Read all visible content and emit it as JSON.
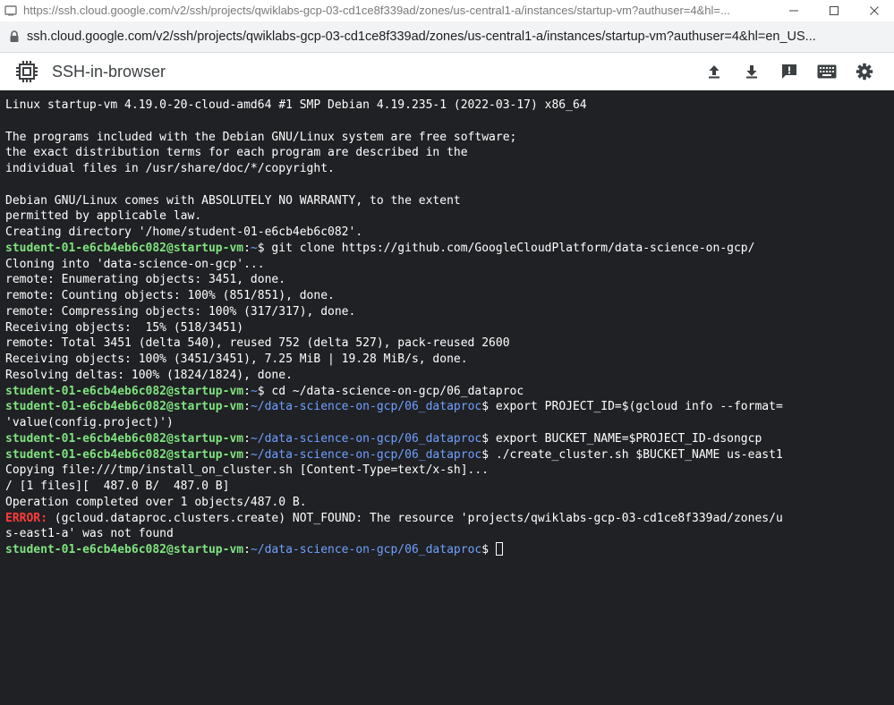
{
  "window": {
    "title": "https://ssh.cloud.google.com/v2/ssh/projects/qwiklabs-gcp-03-cd1ce8f339ad/zones/us-central1-a/instances/startup-vm?authuser=4&hl=..."
  },
  "address_bar": {
    "url": "ssh.cloud.google.com/v2/ssh/projects/qwiklabs-gcp-03-cd1ce8f339ad/zones/us-central1-a/instances/startup-vm?authuser=4&hl=en_US..."
  },
  "app": {
    "title": "SSH-in-browser",
    "tools": [
      {
        "name": "upload-icon"
      },
      {
        "name": "download-icon"
      },
      {
        "name": "feedback-icon"
      },
      {
        "name": "keyboard-icon"
      },
      {
        "name": "settings-icon"
      }
    ]
  },
  "terminal": {
    "prompt_user": "student-01-e6cb4eb6c082@startup-vm",
    "home_path": "~",
    "project_path": "~/data-science-on-gcp/06_dataproc",
    "lines": [
      {
        "t": "text",
        "text": "Linux startup-vm 4.19.0-20-cloud-amd64 #1 SMP Debian 4.19.235-1 (2022-03-17) x86_64"
      },
      {
        "t": "blank"
      },
      {
        "t": "text",
        "text": "The programs included with the Debian GNU/Linux system are free software;"
      },
      {
        "t": "text",
        "text": "the exact distribution terms for each program are described in the"
      },
      {
        "t": "text",
        "text": "individual files in /usr/share/doc/*/copyright."
      },
      {
        "t": "blank"
      },
      {
        "t": "text",
        "text": "Debian GNU/Linux comes with ABSOLUTELY NO WARRANTY, to the extent"
      },
      {
        "t": "text",
        "text": "permitted by applicable law."
      },
      {
        "t": "text",
        "text": "Creating directory '/home/student-01-e6cb4eb6c082'."
      },
      {
        "t": "prompt",
        "user": "student-01-e6cb4eb6c082@startup-vm",
        "path": "~",
        "cmd": "git clone https://github.com/GoogleCloudPlatform/data-science-on-gcp/"
      },
      {
        "t": "text",
        "text": "Cloning into 'data-science-on-gcp'..."
      },
      {
        "t": "text",
        "text": "remote: Enumerating objects: 3451, done."
      },
      {
        "t": "text",
        "text": "remote: Counting objects: 100% (851/851), done."
      },
      {
        "t": "text",
        "text": "remote: Compressing objects: 100% (317/317), done."
      },
      {
        "t": "text",
        "text": "Receiving objects:  15% (518/3451)"
      },
      {
        "t": "text",
        "text": "remote: Total 3451 (delta 540), reused 752 (delta 527), pack-reused 2600"
      },
      {
        "t": "text",
        "text": "Receiving objects: 100% (3451/3451), 7.25 MiB | 19.28 MiB/s, done."
      },
      {
        "t": "text",
        "text": "Resolving deltas: 100% (1824/1824), done."
      },
      {
        "t": "prompt",
        "user": "student-01-e6cb4eb6c082@startup-vm",
        "path": "~",
        "cmd": "cd ~/data-science-on-gcp/06_dataproc"
      },
      {
        "t": "prompt",
        "user": "student-01-e6cb4eb6c082@startup-vm",
        "path": "~/data-science-on-gcp/06_dataproc",
        "cmd": "export PROJECT_ID=$(gcloud info --format="
      },
      {
        "t": "text",
        "text": "'value(config.project)')"
      },
      {
        "t": "prompt",
        "user": "student-01-e6cb4eb6c082@startup-vm",
        "path": "~/data-science-on-gcp/06_dataproc",
        "cmd": "export BUCKET_NAME=$PROJECT_ID-dsongcp"
      },
      {
        "t": "prompt",
        "user": "student-01-e6cb4eb6c082@startup-vm",
        "path": "~/data-science-on-gcp/06_dataproc",
        "cmd": "./create_cluster.sh $BUCKET_NAME us-east1"
      },
      {
        "t": "text",
        "text": "Copying file:///tmp/install_on_cluster.sh [Content-Type=text/x-sh]..."
      },
      {
        "t": "text",
        "text": "/ [1 files][  487.0 B/  487.0 B]"
      },
      {
        "t": "text",
        "text": "Operation completed over 1 objects/487.0 B."
      },
      {
        "t": "error",
        "label": "ERROR:",
        "text": " (gcloud.dataproc.clusters.create) NOT_FOUND: The resource 'projects/qwiklabs-gcp-03-cd1ce8f339ad/zones/u"
      },
      {
        "t": "text",
        "text": "s-east1-a' was not found"
      },
      {
        "t": "input",
        "user": "student-01-e6cb4eb6c082@startup-vm",
        "path": "~/data-science-on-gcp/06_dataproc",
        "cmd": ""
      }
    ]
  },
  "colors": {
    "terminal_bg": "#202124",
    "terminal_text": "#ffffff",
    "prompt_user": "#7fe37f",
    "prompt_path": "#6ea0ff",
    "error": "#ff3b3b"
  }
}
